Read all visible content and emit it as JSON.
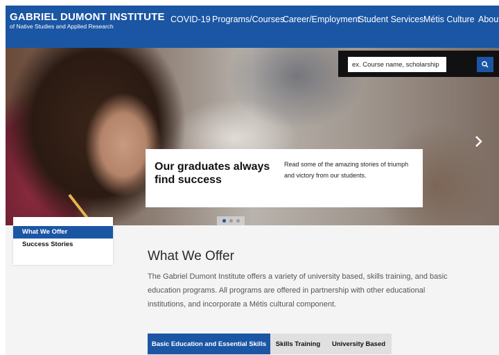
{
  "header": {
    "brand_title": "GABRIEL DUMONT INSTITUTE",
    "brand_subtitle": "of Native Studies and Applied Research",
    "nav": [
      "COVID-19",
      "Programs/Courses",
      "Career/Employment",
      "Student Services",
      "Métis Culture",
      "About"
    ]
  },
  "hero": {
    "search_placeholder": "ex. Course name, scholarship",
    "caption_title": "Our graduates always find success",
    "caption_text": "Read some of the amazing stories of triumph and victory from our students.",
    "slide_count": 3,
    "active_slide": 1
  },
  "sidebar": {
    "items": [
      "What We Offer",
      "Success Stories"
    ],
    "active": "What We Offer"
  },
  "main": {
    "title": "What We Offer",
    "body": "The Gabriel Dumont Institute offers a variety of university based, skills training, and basic education programs. All programs are offered in partnership with other educational institutions, and incorporate a Métis cultural component.",
    "tabs": [
      "Basic Education and Essential Skills",
      "Skills Training",
      "University Based"
    ],
    "active_tab": "Basic Education and Essential Skills"
  },
  "colors": {
    "brand_blue": "#1b56a4",
    "tab_inactive": "#e0e0e0",
    "content_bg": "#f4f4f4"
  },
  "icons": [
    "search-icon",
    "chevron-right-icon"
  ]
}
